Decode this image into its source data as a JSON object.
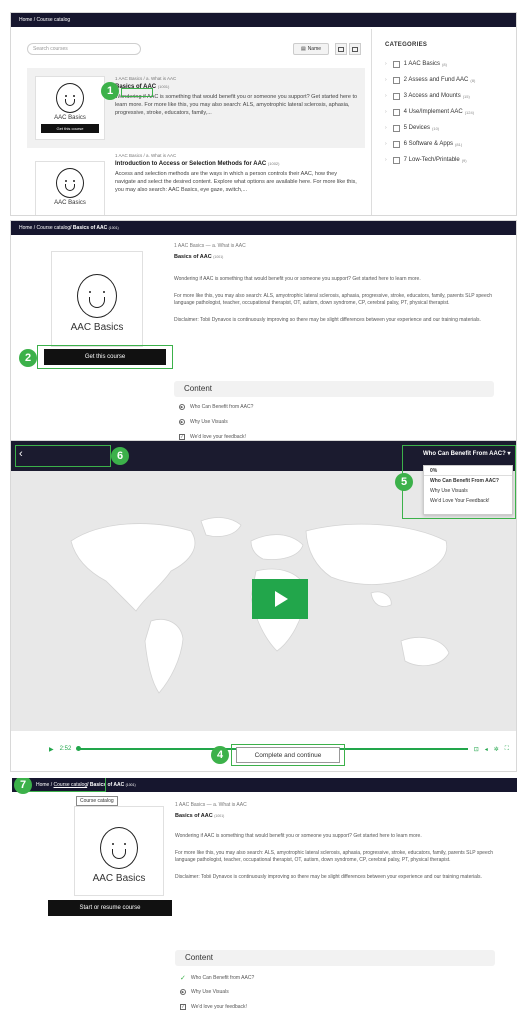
{
  "catalog": {
    "breadcrumb": "Home / Course catalog",
    "search_placeholder": "Search courses",
    "sort_label": "Name",
    "categories_title": "CATEGORIES",
    "categories": [
      {
        "label": "1 AAC Basics",
        "count": "(8)"
      },
      {
        "label": "2 Assess and Fund AAC",
        "count": "(8)"
      },
      {
        "label": "3 Access and Mounts",
        "count": "(15)"
      },
      {
        "label": "4 Use/Implement AAC",
        "count": "(124)"
      },
      {
        "label": "5 Devices",
        "count": "(10)"
      },
      {
        "label": "6 Software & Apps",
        "count": "(81)"
      },
      {
        "label": "7 Low-Tech/Printable",
        "count": "(9)"
      }
    ],
    "courses": [
      {
        "crumb": "1 AAC Basics / a. What is AAC",
        "title": "Basics of AAC",
        "code": "(1001)",
        "image_label": "AAC Basics",
        "button": "Get this course",
        "description": "Wondering if AAC is something that would benefit you or someone you support? Get started here to learn more. For more like this, you may also search: ALS, amyotrophic lateral sclerosis, aphasia, progressive, stroke, educators, family,..."
      },
      {
        "crumb": "1 AAC Basics / a. What is AAC",
        "title": "Introduction to Access or Selection Methods for AAC",
        "code": "(1002)",
        "image_label": "AAC Basics",
        "description": "Access and selection methods are the ways in which a person controls their AAC, how they navigate and select the desired content. Explore what options are available here. For more like this, you may also search: AAC Basics, eye gaze, switch,..."
      }
    ]
  },
  "course": {
    "breadcrumb_home": "Home /",
    "breadcrumb_catalog": "Course catalog",
    "breadcrumb_course": "/ Basics of AAC",
    "breadcrumb_code": "(1001)",
    "image_label": "AAC Basics",
    "get_button": "Get this course",
    "resume_button": "Start or resume course",
    "crumb": "1 AAC Basics — a. What is AAC",
    "title": "Basics of AAC",
    "code": "(1001)",
    "intro": "Wondering if AAC is something that would benefit you or someone you support? Get started here to learn more.",
    "search_text": "For more like this, you may also search: ALS, amyotrophic lateral sclerosis, aphasia, progressive, stroke, educators, family, parents SLP speech language pathologist, teacher, occupational therapist, OT, autism, down syndrome, CP, cerebral palsy, PT, physical therapist.",
    "disclaimer": "Disclaimer: Tobii Dynavox is continuously improving so there may be slight differences between your experience and our training materials.",
    "content_heading": "Content",
    "items": [
      "Who Can Benefit from AAC?",
      "Why Use Visuals",
      "We'd love your feedback!"
    ]
  },
  "player": {
    "dropdown_label": "Who Can Benefit From AAC?",
    "progress": "0%",
    "menu_items": [
      "Who Can Benefit From AAC?",
      "Why Use Visuals",
      "We'd Love Your Feedback!"
    ],
    "time": "2:52",
    "complete_button": "Complete and continue"
  },
  "tooltip": "Course catalog",
  "callouts": {
    "c1": "1",
    "c2": "2",
    "c4": "4",
    "c5": "5",
    "c6": "6",
    "c7": "7"
  },
  "colors": {
    "accent": "#3cb14a",
    "nav": "#16162e",
    "player_green": "#22a64b"
  }
}
